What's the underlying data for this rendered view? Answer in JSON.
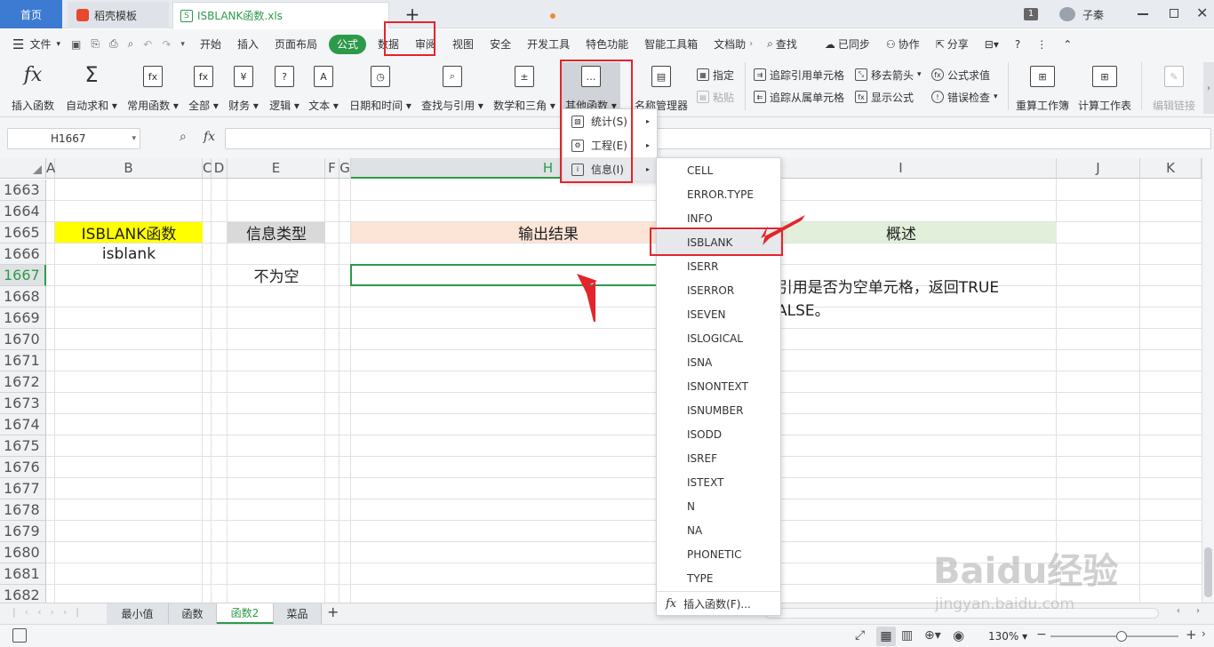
{
  "tabs": {
    "home": "首页",
    "template": "稻壳模板",
    "file": "ISBLANK函数.xls",
    "add": "+"
  },
  "window": {
    "badge": "1",
    "user": "子秦"
  },
  "menu": {
    "file": "文件",
    "items": [
      "开始",
      "插入",
      "页面布局",
      "公式",
      "数据",
      "审阅",
      "视图",
      "安全",
      "开发工具",
      "特色功能",
      "智能工具箱",
      "文档助"
    ],
    "active": "公式",
    "search": "查找",
    "sync": "已同步",
    "collab": "协作",
    "share": "分享",
    "help": "?"
  },
  "ribbon": {
    "insert_fn": "插入函数",
    "autosum": "自动求和",
    "common": "常用函数",
    "all": "全部",
    "finance": "财务",
    "logic": "逻辑",
    "text": "文本",
    "datetime": "日期和时间",
    "lookup": "查找与引用",
    "math": "数学和三角",
    "other": "其他函数",
    "name_mgr": "名称管理器",
    "define": "指定",
    "paste": "粘贴",
    "trace_prec": "追踪引用单元格",
    "trace_dep": "追踪从属单元格",
    "remove_arrows": "移去箭头",
    "show_formula": "显示公式",
    "eval": "公式求值",
    "error_check": "错误检查",
    "recalc_book": "重算工作簿",
    "calc_sheet": "计算工作表",
    "edit_links": "编辑链接"
  },
  "formula_bar": {
    "name_box": "H1667",
    "fx": "fx",
    "value": ""
  },
  "columns": [
    "A",
    "B",
    "C",
    "D",
    "E",
    "F",
    "G",
    "H",
    "I",
    "J",
    "K"
  ],
  "rows": [
    "1663",
    "1664",
    "1665",
    "1666",
    "1667",
    "1668",
    "1669",
    "1670",
    "1671",
    "1672",
    "1673",
    "1674",
    "1675",
    "1676",
    "1677",
    "1678",
    "1679",
    "1680",
    "1681",
    "1682"
  ],
  "cells": {
    "b1665": "ISBLANK函数",
    "b1666": "isblank",
    "e1665": "信息类型",
    "e1667": "不为空",
    "h1665": "输出结果",
    "i1665": "概述",
    "i1667": "检验引用是否为空单元格，返回TRUE",
    "i1668": "或FALSE。",
    "i1667_visible": "E引用是否为空单元格，返回TRUE",
    "i1668_visible": "ALSE。"
  },
  "colors": {
    "yellow": "#ffff00",
    "gray": "#d9d9d9",
    "peach": "#fce4d6",
    "green_light": "#e2efda",
    "accent_green": "#2d9a4a",
    "red": "#e3242b"
  },
  "submenu": {
    "stat": "统计(S)",
    "eng": "工程(E)",
    "info": "信息(I)"
  },
  "info_functions": [
    "CELL",
    "ERROR.TYPE",
    "INFO",
    "ISBLANK",
    "ISERR",
    "ISERROR",
    "ISEVEN",
    "ISLOGICAL",
    "ISNA",
    "ISNONTEXT",
    "ISNUMBER",
    "ISODD",
    "ISREF",
    "ISTEXT",
    "N",
    "NA",
    "PHONETIC",
    "TYPE"
  ],
  "insert_fn_item": "插入函数(F)...",
  "sheets": [
    "最小值",
    "函数",
    "函数2",
    "菜品"
  ],
  "active_sheet": "函数2",
  "zoom": "130%",
  "watermark": {
    "text": "Baidu经验",
    "url": "jingyan.baidu.com"
  }
}
